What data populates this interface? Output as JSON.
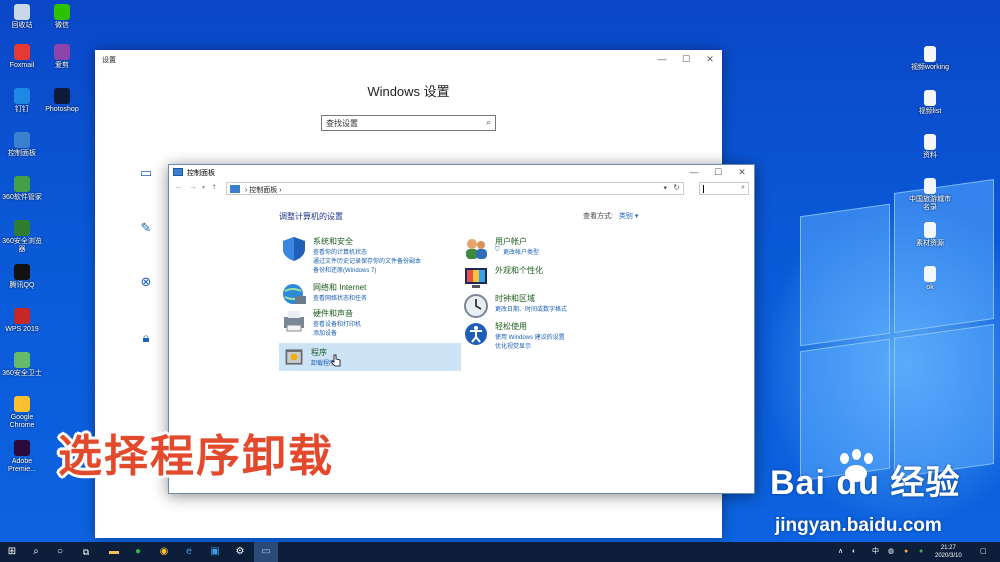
{
  "desktop": {
    "left_icons": [
      {
        "label": "回收站",
        "color": "#c8d8e8"
      },
      {
        "label": "微信",
        "color": "#2dc100"
      },
      {
        "label": "Foxmail",
        "color": "#e53935"
      },
      {
        "label": "爱剪",
        "color": "#8e44ad"
      },
      {
        "label": "钉钉",
        "color": "#1e88e5"
      },
      {
        "label": "Photoshop",
        "color": "#0b1a3a"
      },
      {
        "label": "控制面板",
        "color": "#3a7fd0"
      },
      {
        "label": "360软件管家",
        "color": "#43a047"
      },
      {
        "label": "360安全浏览器",
        "color": "#2e7d32"
      },
      {
        "label": "腾讯QQ",
        "color": "#111111"
      },
      {
        "label": "WPS 2019",
        "color": "#c62828"
      },
      {
        "label": "360安全卫士",
        "color": "#66bb6a"
      },
      {
        "label": "Google Chrome",
        "color": "#fbc02d"
      },
      {
        "label": "Adobe Premie...",
        "color": "#2a0a3a"
      }
    ],
    "right_icons": [
      {
        "label": "视频working"
      },
      {
        "label": "视频list"
      },
      {
        "label": "资料"
      },
      {
        "label": "中国旅游城市名录"
      },
      {
        "label": "素材资源"
      },
      {
        "label": "ok"
      }
    ]
  },
  "settings_window": {
    "title": "设置",
    "heading": "Windows 设置",
    "search_value": "查找设置",
    "controls": {
      "minimize": "—",
      "maximize": "☐",
      "close": "✕"
    }
  },
  "control_panel": {
    "title": "控制面板",
    "breadcrumb": "控制面板",
    "heading": "调整计算机的设置",
    "view_by_label": "查看方式:",
    "view_by_value": "类别 ▾",
    "controls": {
      "minimize": "—",
      "maximize": "☐",
      "close": "✕"
    },
    "categories": {
      "system": {
        "title": "系统和安全",
        "links": [
          "查看你的计算机状态",
          "通过文件历史记录保存你的文件备份副本",
          "备份和还原(Windows 7)"
        ]
      },
      "network": {
        "title": "网络和 Internet",
        "links": [
          "查看网络状态和任务"
        ]
      },
      "hardware": {
        "title": "硬件和声音",
        "links": [
          "查看设备和打印机",
          "添加设备"
        ]
      },
      "programs": {
        "title": "程序",
        "links": [
          "卸载程序"
        ]
      },
      "user": {
        "title": "用户帐户",
        "links": [
          "更改帐户类型"
        ]
      },
      "appearance": {
        "title": "外观和个性化",
        "links": []
      },
      "clock": {
        "title": "时钟和区域",
        "links": [
          "更改日期、时间或数字格式"
        ]
      },
      "ease": {
        "title": "轻松使用",
        "links": [
          "使用 Windows 建议的设置",
          "优化视觉显示"
        ]
      }
    }
  },
  "overlay": {
    "caption": "选择程序卸载"
  },
  "watermark": {
    "brand": "Bai du 经验",
    "url": "jingyan.baidu.com"
  },
  "taskbar": {
    "time": "21:27",
    "date": "2020/3/10",
    "ime": "中",
    "tray_extra": "∧"
  }
}
